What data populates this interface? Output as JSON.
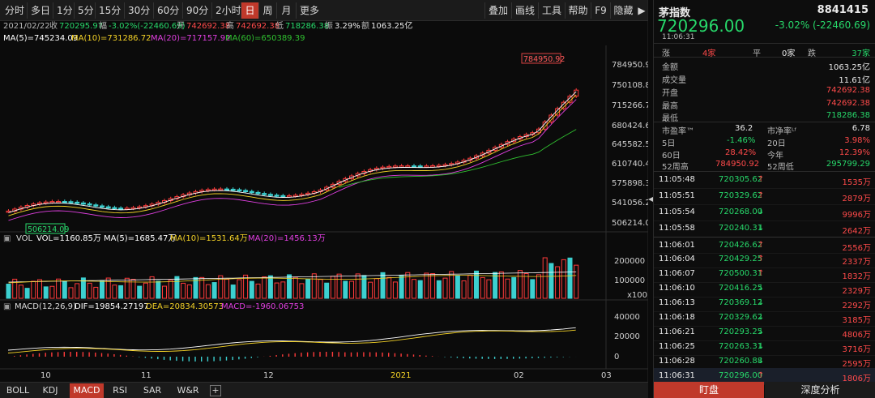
{
  "toolbar": {
    "periods": [
      "分时",
      "多日",
      "1分",
      "5分",
      "15分",
      "30分",
      "60分",
      "90分",
      "2小时",
      "日",
      "周",
      "月",
      "更多"
    ],
    "active_period": "日",
    "right_buttons": [
      "叠加",
      "画线",
      "工具",
      "帮助",
      "F9",
      "隐藏"
    ],
    "hide_arrow": "▶"
  },
  "info": {
    "date": "2021/02/22",
    "close_label": "收",
    "close": "720295.97",
    "change_label": "幅",
    "change": "-3.02%(-22460.69)",
    "open_label": "开",
    "open": "742692.38",
    "high_label": "高",
    "high": "742692.38",
    "low_label": "低",
    "low": "718286.38",
    "amp_label": "振",
    "amp": "3.29%",
    "amount_label": "额",
    "amount": "1063.25亿"
  },
  "ma": {
    "ma5": "MA(5)=745234.09",
    "ma10": "MA(10)=731286.72",
    "ma20": "MA(20)=717157.92",
    "ma60": "MA(60)=650389.39",
    "colors": {
      "ma5": "#ffffff",
      "ma10": "#f5d327",
      "ma20": "#e03fe0",
      "ma60": "#30c030"
    }
  },
  "price_axis": {
    "labels": [
      "784950.9",
      "750108.8",
      "715266.7",
      "680424.6",
      "645582.5",
      "610740.4",
      "575898.3",
      "541056.2",
      "506214.0"
    ],
    "max_label": "784950.92",
    "min_label": "506214.09"
  },
  "vol": {
    "label": "VOL",
    "vol": "VOL=1160.85万",
    "ma5": "MA(5)=1685.47万",
    "ma10": "MA(10)=1531.64万",
    "ma20": "MA(20)=1456.13万",
    "axis": [
      "200000",
      "100000",
      "x100"
    ]
  },
  "macd": {
    "label": "MACD(12,26,9)",
    "dif": "DIF=19854.27197",
    "dea": "DEA=20834.30573",
    "macd": "MACD=-1960.06753",
    "axis": [
      "40000",
      "20000",
      "0"
    ]
  },
  "x_axis": [
    "10",
    "11",
    "12",
    "2021",
    "02",
    "03"
  ],
  "bottom_tabs": [
    "BOLL",
    "KDJ",
    "MACD",
    "RSI",
    "SAR",
    "W&R",
    "+"
  ],
  "active_tab": "MACD",
  "quote": {
    "name": "茅指数",
    "code": "8841415",
    "price": "720296.00",
    "change": "-3.02% (-22460.69)",
    "time": "11:06:31",
    "up_label": "涨",
    "up_count": "4家",
    "flat_label": "平",
    "flat_count": "0家",
    "down_label": "跌",
    "down_count": "37家",
    "stats": [
      {
        "label": "金额",
        "value": "1063.25亿",
        "color": "white"
      },
      {
        "label": "成交量",
        "value": "11.61亿",
        "color": "white"
      },
      {
        "label": "开盘",
        "value": "742692.38",
        "color": "red"
      },
      {
        "label": "最高",
        "value": "742692.38",
        "color": "red"
      },
      {
        "label": "最低",
        "value": "718286.38",
        "color": "green"
      }
    ],
    "pe_label": "市盈率™",
    "pe_value": "36.2",
    "pb_label": "市净率ᴸᶠ",
    "pb_value": "6.78",
    "d5_label": "5日",
    "d5_value": "-1.46%",
    "d20_label": "20日",
    "d20_value": "3.98%",
    "d60_label": "60日",
    "d60_value": "28.42%",
    "ytd_label": "今年",
    "ytd_value": "12.39%",
    "w52h_label": "52周高",
    "w52h_value": "784950.92",
    "w52l_label": "52周低",
    "w52l_value": "295799.29"
  },
  "trades": [
    {
      "time": "11:05:48",
      "price": "720305.62",
      "dir": "up",
      "vol": "1535万"
    },
    {
      "time": "11:05:51",
      "price": "720329.62",
      "dir": "up",
      "vol": "2879万"
    },
    {
      "time": "11:05:54",
      "price": "720268.00",
      "dir": "down",
      "vol": "9996万"
    },
    {
      "time": "11:05:58",
      "price": "720240.31",
      "dir": "down",
      "vol": "2642万"
    },
    {
      "time": "11:06:01",
      "price": "720426.62",
      "dir": "up",
      "vol": "2556万"
    },
    {
      "time": "11:06:04",
      "price": "720429.25",
      "dir": "up",
      "vol": "2337万"
    },
    {
      "time": "11:06:07",
      "price": "720500.31",
      "dir": "up",
      "vol": "1832万"
    },
    {
      "time": "11:06:10",
      "price": "720416.25",
      "dir": "down",
      "vol": "2329万"
    },
    {
      "time": "11:06:13",
      "price": "720369.12",
      "dir": "down",
      "vol": "2292万"
    },
    {
      "time": "11:06:18",
      "price": "720329.62",
      "dir": "down",
      "vol": "3185万"
    },
    {
      "time": "11:06:21",
      "price": "720293.25",
      "dir": "down",
      "vol": "4806万"
    },
    {
      "time": "11:06:25",
      "price": "720263.31",
      "dir": "down",
      "vol": "3716万"
    },
    {
      "time": "11:06:28",
      "price": "720260.88",
      "dir": "down",
      "vol": "2595万"
    },
    {
      "time": "11:06:31",
      "price": "720296.00",
      "dir": "up",
      "vol": "1806万"
    }
  ],
  "rp_buttons": {
    "watch": "盯盘",
    "depth": "深度分析"
  },
  "side_toggle": "◀"
}
